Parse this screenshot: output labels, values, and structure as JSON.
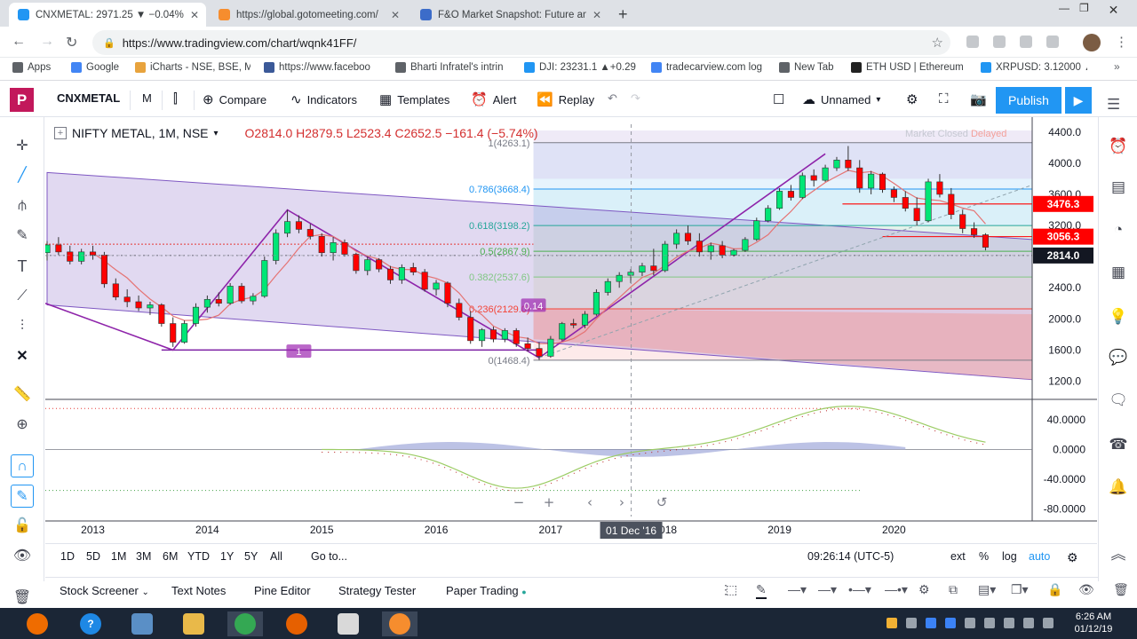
{
  "browser": {
    "tabs": [
      {
        "title": "CNXMETAL: 2971.25 ▼ −0.04% — ",
        "active": true,
        "color": "#2196f3"
      },
      {
        "title": "https://global.gotomeeting.com/",
        "active": false,
        "color": "#f68d2e"
      },
      {
        "title": "F&O Market Snapshot: Future an",
        "active": false,
        "color": "#3c6cc9"
      }
    ],
    "url": "https://www.tradingview.com/chart/wqnk41FF/",
    "bookmarks": [
      {
        "label": "Apps",
        "color": "#5f6368"
      },
      {
        "label": "Google",
        "color": "#4285f4"
      },
      {
        "label": "iCharts - NSE, BSE, M",
        "color": "#e8a33d"
      },
      {
        "label": "https://www.faceboo",
        "color": "#3b5998"
      },
      {
        "label": "Bharti Infratel's intrin",
        "color": "#5f6368"
      },
      {
        "label": "DJI: 23231.1 ▲+0.29",
        "color": "#2196f3"
      },
      {
        "label": "tradecarview.com log",
        "color": "#4285f4"
      },
      {
        "label": "New Tab",
        "color": "#5f6368"
      },
      {
        "label": "ETH USD | Ethereum",
        "color": "#222"
      },
      {
        "label": "XRPUSD: 3.12000 ▲",
        "color": "#2196f3"
      }
    ]
  },
  "toolbar": {
    "symbol": "CNXMETAL",
    "interval": "M",
    "compare": "Compare",
    "indicators": "Indicators",
    "templates": "Templates",
    "alert": "Alert",
    "replay": "Replay",
    "layout_name": "Unnamed",
    "publish": "Publish"
  },
  "legend": {
    "title": "NIFTY METAL, 1M, NSE",
    "ohlc": "O2814.0  H2879.5  L2523.4  C2652.5  −161.4 (−5.74%)",
    "market_status": "Market Closed",
    "delay": "Delayed"
  },
  "colors": {
    "up": "#00e676",
    "down": "#ff0000",
    "accent": "#2196f3",
    "purple": "#9c27b0"
  },
  "chart_data": {
    "type": "candlestick",
    "title": "NIFTY METAL, 1M, NSE",
    "x_ticks": [
      "2013",
      "2014",
      "2015",
      "2016",
      "2017",
      "2018",
      "2019",
      "2020"
    ],
    "y_ticks": [
      "4400.0",
      "4000.0",
      "3600.0",
      "3200.0",
      "2800.0",
      "2400.0",
      "2000.0",
      "1600.0",
      "1200.0"
    ],
    "ylim": [
      1000,
      4500
    ],
    "price_labels": [
      {
        "value": 3476.3,
        "label": "3476.3",
        "color": "#ff0000"
      },
      {
        "value": 3056.3,
        "label": "3056.3",
        "color": "#ff0000"
      },
      {
        "value": 2814.0,
        "label": "2814.0",
        "color": "#131722"
      }
    ],
    "fib_levels": [
      {
        "label": "1(4263.1)",
        "value": 4263.1,
        "color": "#787b86"
      },
      {
        "label": "0.786(3668.4)",
        "value": 3668.4,
        "color": "#2196f3"
      },
      {
        "label": "0.618(3198.2)",
        "value": 3198.2,
        "color": "#26a69a"
      },
      {
        "label": "0.5(2867.9)",
        "value": 2867.9,
        "color": "#4caf50"
      },
      {
        "label": "0.382(2537.6)",
        "value": 2537.6,
        "color": "#81c784"
      },
      {
        "label": "0.236(2129.0)",
        "value": 2129.0,
        "color": "#f44336"
      },
      {
        "label": "0(1468.4)",
        "value": 1468.4,
        "color": "#787b86"
      }
    ],
    "annotations": [
      {
        "text": "0.14",
        "x": 2016.85,
        "y": 2170
      },
      {
        "text": "1",
        "x": 2014.8,
        "y": 1580
      }
    ],
    "candles": [
      {
        "t": 2012.6,
        "o": 2850,
        "h": 3000,
        "l": 2750,
        "c": 2950
      },
      {
        "t": 2012.7,
        "o": 2950,
        "h": 3050,
        "l": 2820,
        "c": 2860
      },
      {
        "t": 2012.8,
        "o": 2860,
        "h": 2940,
        "l": 2700,
        "c": 2740
      },
      {
        "t": 2012.9,
        "o": 2740,
        "h": 2900,
        "l": 2700,
        "c": 2860
      },
      {
        "t": 2013.0,
        "o": 2860,
        "h": 2940,
        "l": 2760,
        "c": 2820
      },
      {
        "t": 2013.1,
        "o": 2820,
        "h": 2860,
        "l": 2400,
        "c": 2450
      },
      {
        "t": 2013.2,
        "o": 2450,
        "h": 2520,
        "l": 2240,
        "c": 2280
      },
      {
        "t": 2013.3,
        "o": 2280,
        "h": 2380,
        "l": 2150,
        "c": 2220
      },
      {
        "t": 2013.4,
        "o": 2220,
        "h": 2300,
        "l": 2100,
        "c": 2140
      },
      {
        "t": 2013.5,
        "o": 2140,
        "h": 2220,
        "l": 2050,
        "c": 2180
      },
      {
        "t": 2013.6,
        "o": 2180,
        "h": 2200,
        "l": 1900,
        "c": 1940
      },
      {
        "t": 2013.7,
        "o": 1940,
        "h": 2020,
        "l": 1640,
        "c": 1700
      },
      {
        "t": 2013.8,
        "o": 1700,
        "h": 1980,
        "l": 1680,
        "c": 1940
      },
      {
        "t": 2013.9,
        "o": 1940,
        "h": 2200,
        "l": 1900,
        "c": 2150
      },
      {
        "t": 2014.0,
        "o": 2150,
        "h": 2300,
        "l": 2080,
        "c": 2250
      },
      {
        "t": 2014.1,
        "o": 2250,
        "h": 2340,
        "l": 2160,
        "c": 2200
      },
      {
        "t": 2014.2,
        "o": 2200,
        "h": 2460,
        "l": 2180,
        "c": 2420
      },
      {
        "t": 2014.3,
        "o": 2420,
        "h": 2460,
        "l": 2200,
        "c": 2230
      },
      {
        "t": 2014.4,
        "o": 2230,
        "h": 2330,
        "l": 2180,
        "c": 2290
      },
      {
        "t": 2014.5,
        "o": 2290,
        "h": 2800,
        "l": 2270,
        "c": 2750
      },
      {
        "t": 2014.6,
        "o": 2750,
        "h": 3150,
        "l": 2700,
        "c": 3100
      },
      {
        "t": 2014.7,
        "o": 3100,
        "h": 3400,
        "l": 3050,
        "c": 3250
      },
      {
        "t": 2014.8,
        "o": 3250,
        "h": 3330,
        "l": 3100,
        "c": 3150
      },
      {
        "t": 2014.9,
        "o": 3150,
        "h": 3220,
        "l": 3020,
        "c": 3060
      },
      {
        "t": 2015.0,
        "o": 3060,
        "h": 3100,
        "l": 2800,
        "c": 2850
      },
      {
        "t": 2015.1,
        "o": 2850,
        "h": 3050,
        "l": 2750,
        "c": 2980
      },
      {
        "t": 2015.2,
        "o": 2980,
        "h": 3020,
        "l": 2800,
        "c": 2830
      },
      {
        "t": 2015.3,
        "o": 2830,
        "h": 2850,
        "l": 2580,
        "c": 2620
      },
      {
        "t": 2015.4,
        "o": 2620,
        "h": 2800,
        "l": 2560,
        "c": 2760
      },
      {
        "t": 2015.5,
        "o": 2760,
        "h": 2780,
        "l": 2600,
        "c": 2640
      },
      {
        "t": 2015.6,
        "o": 2640,
        "h": 2680,
        "l": 2450,
        "c": 2500
      },
      {
        "t": 2015.7,
        "o": 2500,
        "h": 2700,
        "l": 2450,
        "c": 2660
      },
      {
        "t": 2015.8,
        "o": 2660,
        "h": 2720,
        "l": 2560,
        "c": 2600
      },
      {
        "t": 2015.9,
        "o": 2600,
        "h": 2640,
        "l": 2350,
        "c": 2380
      },
      {
        "t": 2016.0,
        "o": 2380,
        "h": 2500,
        "l": 2300,
        "c": 2460
      },
      {
        "t": 2016.1,
        "o": 2460,
        "h": 2480,
        "l": 2150,
        "c": 2200
      },
      {
        "t": 2016.2,
        "o": 2200,
        "h": 2260,
        "l": 1980,
        "c": 2020
      },
      {
        "t": 2016.3,
        "o": 2020,
        "h": 2100,
        "l": 1680,
        "c": 1720
      },
      {
        "t": 2016.4,
        "o": 1720,
        "h": 1880,
        "l": 1640,
        "c": 1860
      },
      {
        "t": 2016.5,
        "o": 1860,
        "h": 1900,
        "l": 1700,
        "c": 1740
      },
      {
        "t": 2016.6,
        "o": 1740,
        "h": 1880,
        "l": 1700,
        "c": 1850
      },
      {
        "t": 2016.7,
        "o": 1850,
        "h": 1880,
        "l": 1640,
        "c": 1680
      },
      {
        "t": 2016.8,
        "o": 1680,
        "h": 1760,
        "l": 1580,
        "c": 1620
      },
      {
        "t": 2016.9,
        "o": 1620,
        "h": 1700,
        "l": 1470,
        "c": 1520
      },
      {
        "t": 2017.0,
        "o": 1520,
        "h": 1780,
        "l": 1500,
        "c": 1740
      },
      {
        "t": 2017.1,
        "o": 1740,
        "h": 1960,
        "l": 1720,
        "c": 1940
      },
      {
        "t": 2017.2,
        "o": 1940,
        "h": 2000,
        "l": 1880,
        "c": 1920
      },
      {
        "t": 2017.3,
        "o": 1920,
        "h": 2100,
        "l": 1880,
        "c": 2060
      },
      {
        "t": 2017.4,
        "o": 2060,
        "h": 2380,
        "l": 2040,
        "c": 2340
      },
      {
        "t": 2017.5,
        "o": 2340,
        "h": 2520,
        "l": 2300,
        "c": 2480
      },
      {
        "t": 2017.6,
        "o": 2480,
        "h": 2600,
        "l": 2400,
        "c": 2560
      },
      {
        "t": 2017.7,
        "o": 2560,
        "h": 2640,
        "l": 2460,
        "c": 2600
      },
      {
        "t": 2017.8,
        "o": 2600,
        "h": 2720,
        "l": 2550,
        "c": 2680
      },
      {
        "t": 2017.9,
        "o": 2680,
        "h": 2900,
        "l": 2560,
        "c": 2620
      },
      {
        "t": 2018.0,
        "o": 2620,
        "h": 3000,
        "l": 2600,
        "c": 2960
      },
      {
        "t": 2018.1,
        "o": 2960,
        "h": 3150,
        "l": 2900,
        "c": 3100
      },
      {
        "t": 2018.2,
        "o": 3100,
        "h": 3200,
        "l": 2950,
        "c": 3000
      },
      {
        "t": 2018.3,
        "o": 3000,
        "h": 3100,
        "l": 2800,
        "c": 2860
      },
      {
        "t": 2018.4,
        "o": 2860,
        "h": 2980,
        "l": 2760,
        "c": 2940
      },
      {
        "t": 2018.5,
        "o": 2940,
        "h": 3000,
        "l": 2780,
        "c": 2820
      },
      {
        "t": 2018.6,
        "o": 2820,
        "h": 2900,
        "l": 2800,
        "c": 2880
      },
      {
        "t": 2018.7,
        "o": 2880,
        "h": 3050,
        "l": 2860,
        "c": 3020
      },
      {
        "t": 2018.8,
        "o": 3020,
        "h": 3300,
        "l": 3000,
        "c": 3260
      },
      {
        "t": 2018.9,
        "o": 3260,
        "h": 3460,
        "l": 3240,
        "c": 3420
      },
      {
        "t": 2019.0,
        "o": 3420,
        "h": 3680,
        "l": 3400,
        "c": 3640
      },
      {
        "t": 2019.1,
        "o": 3640,
        "h": 3720,
        "l": 3520,
        "c": 3560
      },
      {
        "t": 2019.2,
        "o": 3560,
        "h": 3880,
        "l": 3540,
        "c": 3840
      },
      {
        "t": 2019.3,
        "o": 3840,
        "h": 3920,
        "l": 3700,
        "c": 3780
      },
      {
        "t": 2019.4,
        "o": 3780,
        "h": 3980,
        "l": 3760,
        "c": 3940
      },
      {
        "t": 2019.5,
        "o": 3940,
        "h": 4080,
        "l": 3900,
        "c": 4040
      },
      {
        "t": 2019.6,
        "o": 4040,
        "h": 4220,
        "l": 3900,
        "c": 3940
      },
      {
        "t": 2019.7,
        "o": 3940,
        "h": 4040,
        "l": 3620,
        "c": 3680
      },
      {
        "t": 2019.8,
        "o": 3680,
        "h": 3900,
        "l": 3600,
        "c": 3860
      },
      {
        "t": 2019.9,
        "o": 3860,
        "h": 3880,
        "l": 3620,
        "c": 3660
      },
      {
        "t": 2020.0,
        "o": 3660,
        "h": 3700,
        "l": 3500,
        "c": 3560
      },
      {
        "t": 2020.1,
        "o": 3560,
        "h": 3640,
        "l": 3380,
        "c": 3420
      },
      {
        "t": 2020.2,
        "o": 3420,
        "h": 3560,
        "l": 3200,
        "c": 3260
      },
      {
        "t": 2020.3,
        "o": 3260,
        "h": 3800,
        "l": 3240,
        "c": 3760
      },
      {
        "t": 2020.4,
        "o": 3760,
        "h": 3860,
        "l": 3560,
        "c": 3600
      },
      {
        "t": 2020.5,
        "o": 3600,
        "h": 3680,
        "l": 3280,
        "c": 3340
      },
      {
        "t": 2020.6,
        "o": 3340,
        "h": 3400,
        "l": 3100,
        "c": 3160
      },
      {
        "t": 2020.7,
        "o": 3160,
        "h": 3240,
        "l": 3040,
        "c": 3080
      },
      {
        "t": 2020.8,
        "o": 3080,
        "h": 3100,
        "l": 2880,
        "c": 2920
      }
    ],
    "oscillator": {
      "y_ticks": [
        "40.0000",
        "0.0000",
        "-40.0000",
        "-80.0000"
      ],
      "ylim": [
        -90,
        60
      ]
    },
    "crosshair_date": "01 Dec '16"
  },
  "range_bar": {
    "periods": [
      "1D",
      "5D",
      "1M",
      "3M",
      "6M",
      "YTD",
      "1Y",
      "5Y",
      "All"
    ],
    "goto": "Go to...",
    "time": "09:26:14 (UTC-5)",
    "options": [
      "ext",
      "%",
      "log",
      "auto"
    ]
  },
  "bottom_panel": {
    "tabs": [
      "Stock Screener",
      "Text Notes",
      "Pine Editor",
      "Strategy Tester",
      "Paper Trading"
    ]
  },
  "taskbar": {
    "time": "6:26 AM",
    "date": "01/12/19"
  }
}
